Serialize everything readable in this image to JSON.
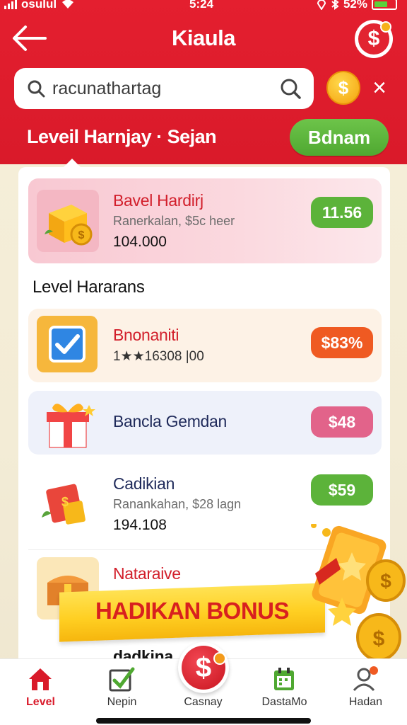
{
  "status_bar": {
    "carrier": "osuƖuƖ",
    "time": "5:24",
    "battery": "52%"
  },
  "header": {
    "title": "Kiaula",
    "level_text": "Leveil Harnjay · Sejan",
    "action_button": "Bdnam"
  },
  "search": {
    "value": "racunathartag",
    "placeholder": "racunathartag"
  },
  "items": [
    {
      "title": "Bavel Hardirj",
      "subtitle": "Ranerkalan, $5c heer",
      "amount": "104.000",
      "pill": "11.56",
      "pill_color": "#5cb33a",
      "title_color": "#d21f2b"
    },
    {
      "title": "Bnonaniti",
      "subtitle": "1★★16308 |00",
      "pill": "$83%",
      "pill_color": "#ef5a22",
      "title_color": "#d21f2b"
    },
    {
      "title": "Bancla Gemdan",
      "pill": "$48",
      "pill_color": "#e2638a",
      "title_color": "#1f2a5a"
    },
    {
      "title": "Cadikian",
      "subtitle": "Ranankahan, $28 lagn",
      "amount": "194.108",
      "pill": "$59",
      "pill_color": "#5cb33a",
      "title_color": "#1f2a5a"
    },
    {
      "title": "Nataraive",
      "title_color": "#d21f2b"
    },
    {
      "title": "dadkina",
      "title_color": "#111111"
    }
  ],
  "section_title": "Level Hararans",
  "bonus_banner": "HADIKAN BONUS",
  "nav": [
    {
      "label": "Level",
      "icon": "home-icon"
    },
    {
      "label": "Nepin",
      "icon": "checkbox-icon"
    },
    {
      "label": "Casnay",
      "icon": "dollar-coin-icon"
    },
    {
      "label": "DastaMo",
      "icon": "calendar-icon"
    },
    {
      "label": "Hadan",
      "icon": "profile-icon"
    }
  ],
  "colors": {
    "header_red": "#d91a2a",
    "accent_green": "#5cb33a",
    "coin_gold": "#f4a20f"
  }
}
